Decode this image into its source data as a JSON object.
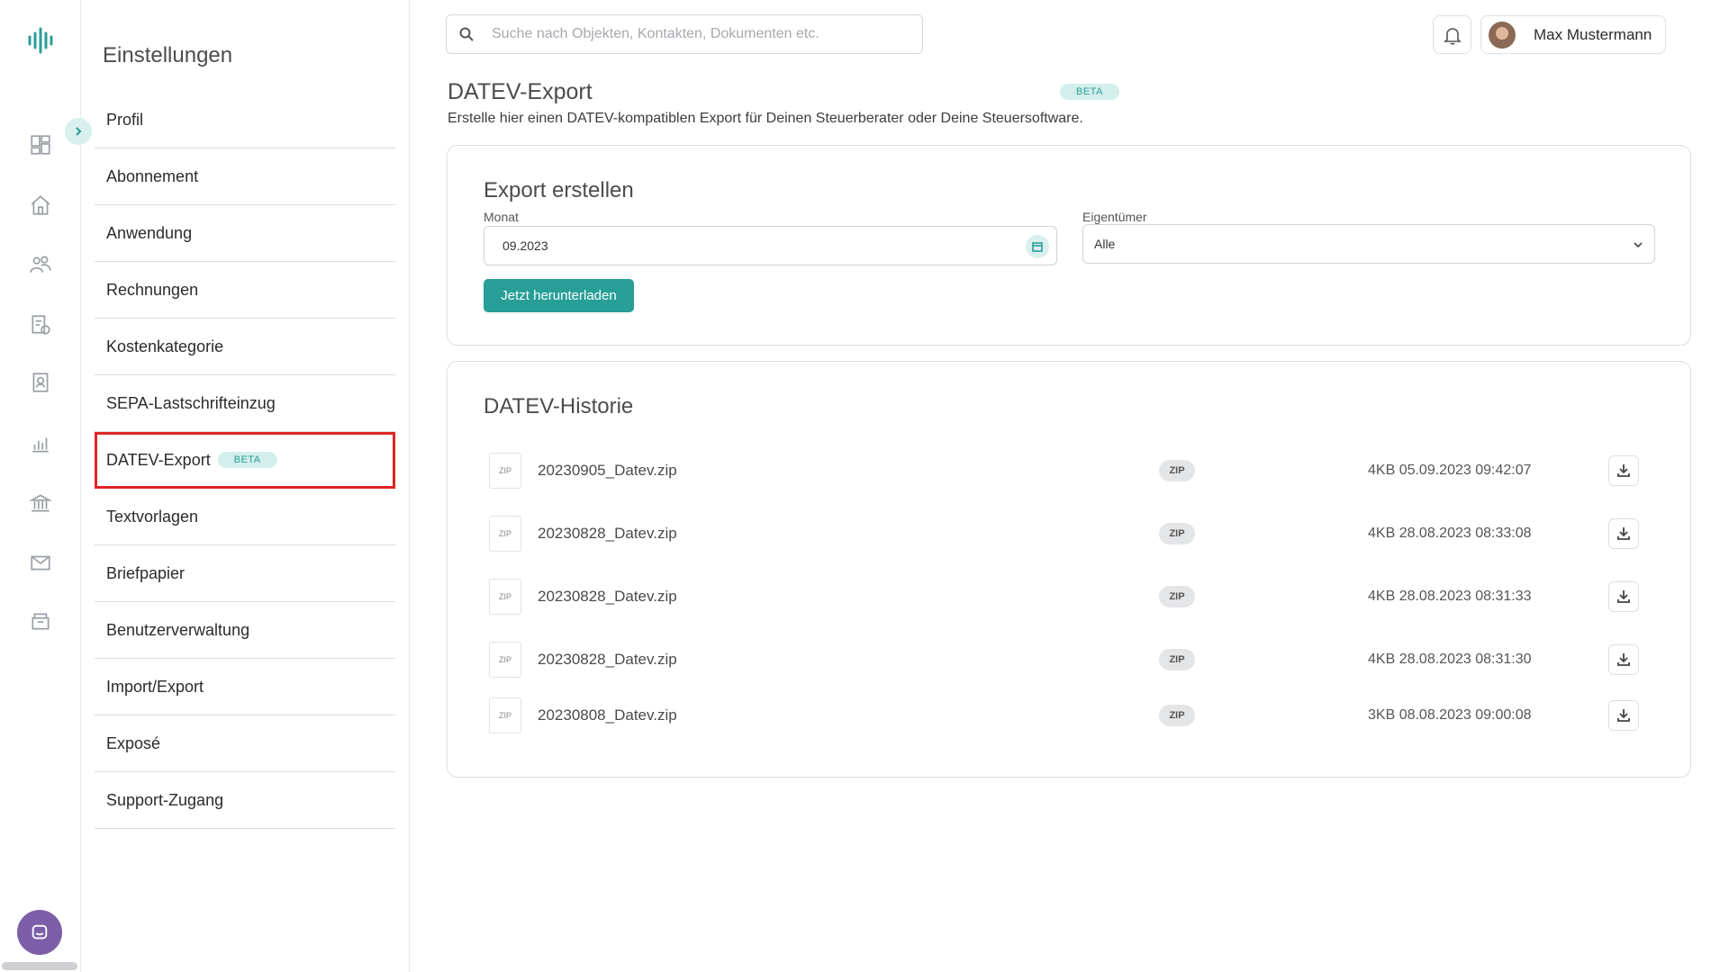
{
  "search": {
    "placeholder": "Suche nach Objekten, Kontakten, Dokumenten etc."
  },
  "user": {
    "name": "Max Mustermann"
  },
  "settings": {
    "title": "Einstellungen",
    "items": [
      {
        "label": "Profil"
      },
      {
        "label": "Abonnement"
      },
      {
        "label": "Anwendung"
      },
      {
        "label": "Rechnungen"
      },
      {
        "label": "Kostenkategorie"
      },
      {
        "label": "SEPA-Lastschrifteinzug"
      },
      {
        "label": "DATEV-Export",
        "badge": "BETA",
        "active": true
      },
      {
        "label": "Textvorlagen"
      },
      {
        "label": "Briefpapier"
      },
      {
        "label": "Benutzerverwaltung"
      },
      {
        "label": "Import/Export"
      },
      {
        "label": "Exposé"
      },
      {
        "label": "Support-Zugang"
      }
    ]
  },
  "page": {
    "title": "DATEV-Export",
    "badge": "BETA",
    "description": "Erstelle hier einen DATEV-kompatiblen Export für Deinen Steuerberater oder Deine Steuersoftware."
  },
  "export": {
    "title": "Export erstellen",
    "month_label": "Monat",
    "month_value": "09.2023",
    "owner_label": "Eigentümer",
    "owner_value": "Alle",
    "button": "Jetzt herunterladen"
  },
  "history": {
    "title": "DATEV-Historie",
    "thumb_label": "ZIP",
    "files": [
      {
        "name": "20230905_Datev.zip",
        "type": "ZIP",
        "meta": "4KB 05.09.2023 09:42:07"
      },
      {
        "name": "20230828_Datev.zip",
        "type": "ZIP",
        "meta": "4KB 28.08.2023 08:33:08"
      },
      {
        "name": "20230828_Datev.zip",
        "type": "ZIP",
        "meta": "4KB 28.08.2023 08:31:33"
      },
      {
        "name": "20230828_Datev.zip",
        "type": "ZIP",
        "meta": "4KB 28.08.2023 08:31:30"
      },
      {
        "name": "20230808_Datev.zip",
        "type": "ZIP",
        "meta": "3KB 08.08.2023 09:00:08"
      }
    ]
  },
  "colors": {
    "accent": "#279e96",
    "highlight": "#e02424",
    "chat": "#7c5ea8"
  }
}
